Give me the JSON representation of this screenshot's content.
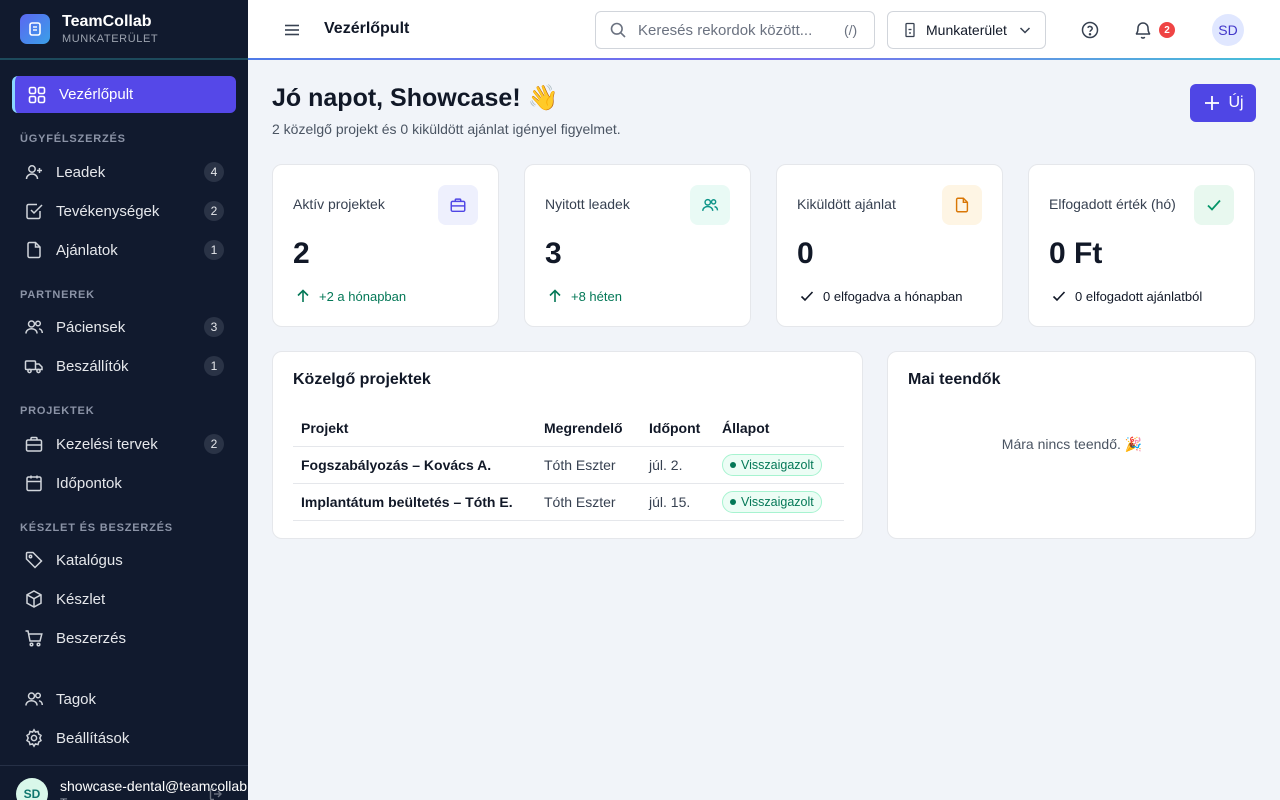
{
  "app": {
    "name": "TeamCollab",
    "subtitle": "MUNKATERÜLET"
  },
  "sidebar": {
    "active": {
      "label": "Vezérlőpult",
      "icon": "grid-icon"
    },
    "sections": [
      {
        "title": "ÜGYFÉLSZERZÉS"
      },
      {
        "title": "PARTNEREK"
      },
      {
        "title": "PROJEKTEK"
      },
      {
        "title": "KÉSZLET ÉS BESZERZÉS"
      }
    ],
    "items": [
      {
        "label": "Leadek",
        "count": "4",
        "icon": "user-plus-icon"
      },
      {
        "label": "Tevékenységek",
        "count": "2",
        "icon": "checkbox-icon"
      },
      {
        "label": "Ajánlatok",
        "count": "1",
        "icon": "document-icon"
      },
      {
        "label": "Páciensek",
        "count": "3",
        "icon": "users-icon"
      },
      {
        "label": "Beszállítók",
        "count": "1",
        "icon": "truck-icon"
      },
      {
        "label": "Kezelési tervek",
        "count": "2",
        "icon": "briefcase-icon"
      },
      {
        "label": "Időpontok",
        "count": "",
        "icon": "calendar-icon"
      },
      {
        "label": "Katalógus",
        "count": "",
        "icon": "tag-icon"
      },
      {
        "label": "Készlet",
        "count": "",
        "icon": "box-icon"
      },
      {
        "label": "Beszerzés",
        "count": "",
        "icon": "cart-icon"
      },
      {
        "label": "Tagok",
        "count": "",
        "icon": "users-icon"
      },
      {
        "label": "Beállítások",
        "count": "",
        "icon": "gear-icon"
      }
    ],
    "user": {
      "initials": "SD",
      "email": "showcase-dental@teamcollab",
      "role": "T..."
    }
  },
  "topbar": {
    "title": "Vezérlőpult",
    "search_placeholder": "Keresés rekordok között...",
    "search_shortcut": "(/)",
    "workspace": "Munkaterület",
    "notifications": "2",
    "avatar": "SD"
  },
  "main": {
    "greeting": "Jó napot, Showcase! 👋",
    "subtitle": "2 közelgő projekt és 0 kiküldött ajánlat igényel figyelmet.",
    "new_button": "Új",
    "stats": [
      {
        "label": "Aktív projektek",
        "value": "2",
        "delta": "+2 a hónapban",
        "icon": "briefcase-icon",
        "color": "#4f46e5"
      },
      {
        "label": "Nyitott leadek",
        "value": "3",
        "delta": "+8 héten",
        "icon": "users-icon",
        "color": "#0d9488"
      },
      {
        "label": "Kiküldött ajánlat",
        "value": "0",
        "delta": "0 elfogadva a hónapban",
        "icon": "document-icon",
        "color": "#d97706"
      },
      {
        "label": "Elfogadott érték (hó)",
        "value": "0 Ft",
        "delta": "0 elfogadott ajánlatból",
        "icon": "check-icon",
        "color": "#059669"
      }
    ],
    "projects": {
      "title": "Közelgő projektek",
      "columns": [
        "Projekt",
        "Megrendelő",
        "Időpont",
        "Állapot"
      ],
      "rows": [
        {
          "project": "Fogszabályozás – Kovács A.",
          "client": "Tóth Eszter",
          "date": "júl. 2.",
          "status": "Visszaigazolt"
        },
        {
          "project": "Implantátum beültetés – Tóth E.",
          "client": "Tóth Eszter",
          "date": "júl. 15.",
          "status": "Visszaigazolt"
        }
      ]
    },
    "todos": {
      "title": "Mai teendők",
      "empty": "Mára nincs teendő. 🎉"
    }
  }
}
